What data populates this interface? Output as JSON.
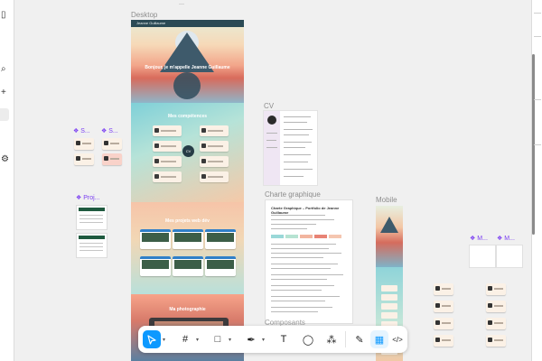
{
  "canvas": {
    "frames": {
      "desktop": {
        "label": "Desktop",
        "hero_title": "Bonjour, je m'appelle Jeanne Guillaume",
        "nav_title": "Jeanne Guillaume",
        "skills_title": "Mes compétences",
        "cv_badge": "CV",
        "projects_title": "Mes projets web dév",
        "photo_title": "Ma photographie"
      },
      "cv": {
        "label": "CV"
      },
      "charte": {
        "label": "Charte graphique",
        "doc_title": "Charte Graphique – Portfolio de Jeanne Guillaume"
      },
      "mobile": {
        "label": "Mobile"
      },
      "components_partial": {
        "label": "Composants"
      }
    },
    "components": {
      "s1": "S...",
      "s2": "S...",
      "proj": "Proj...",
      "m1": "M...",
      "m2": "M..."
    },
    "top_mini": "—"
  },
  "left_rail": {
    "icons": [
      "collapse-icon",
      "search-icon",
      "add-icon",
      "settings-icon"
    ]
  },
  "toolbar": {
    "tools": [
      {
        "name": "move-tool",
        "glyph": "➤",
        "active": true
      },
      {
        "name": "frame-tool",
        "glyph": "#"
      },
      {
        "name": "shape-tool",
        "glyph": "□"
      },
      {
        "name": "pen-tool",
        "glyph": "✒"
      },
      {
        "name": "text-tool",
        "glyph": "T"
      },
      {
        "name": "comment-tool",
        "glyph": "◯"
      },
      {
        "name": "actions-tool",
        "glyph": "⁂"
      },
      {
        "name": "draw-mode",
        "glyph": "✎"
      },
      {
        "name": "design-mode",
        "glyph": "▦",
        "selected": true
      },
      {
        "name": "dev-mode",
        "glyph": "</>"
      }
    ],
    "caret": "▾"
  },
  "colors": {
    "accent": "#0d99ff",
    "component": "#7b3ff2"
  }
}
